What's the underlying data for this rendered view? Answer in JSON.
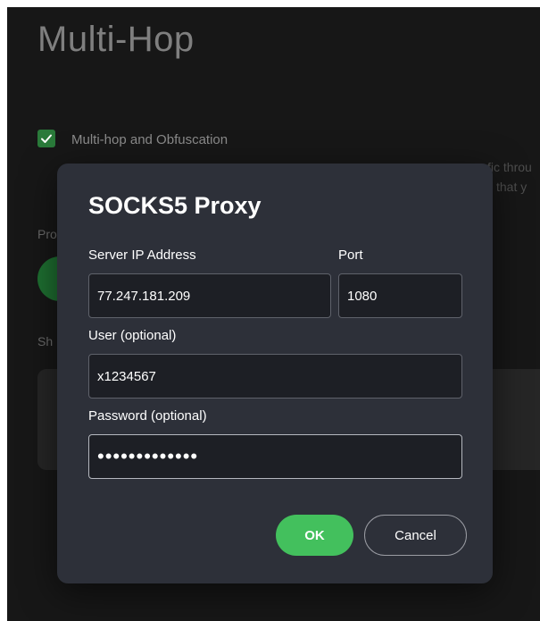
{
  "page": {
    "title": "Multi-Hop",
    "checkbox_label": "Multi-hop and Obfuscation",
    "checkbox_checked": true,
    "desc_line1": "fic throu",
    "desc_line2": "that y",
    "pro_label_fragment": "Pro",
    "show_label_fragment": "Sh"
  },
  "dialog": {
    "title": "SOCKS5 Proxy",
    "server_ip_label": "Server IP Address",
    "server_ip_value": "77.247.181.209",
    "port_label": "Port",
    "port_value": "1080",
    "user_label": "User (optional)",
    "user_value": "x1234567",
    "password_label": "Password (optional)",
    "password_masked": "•••••••••••••",
    "ok_label": "OK",
    "cancel_label": "Cancel"
  },
  "colors": {
    "accent_green": "#43c05d",
    "dialog_bg": "#2d3039",
    "window_bg": "#171717"
  }
}
